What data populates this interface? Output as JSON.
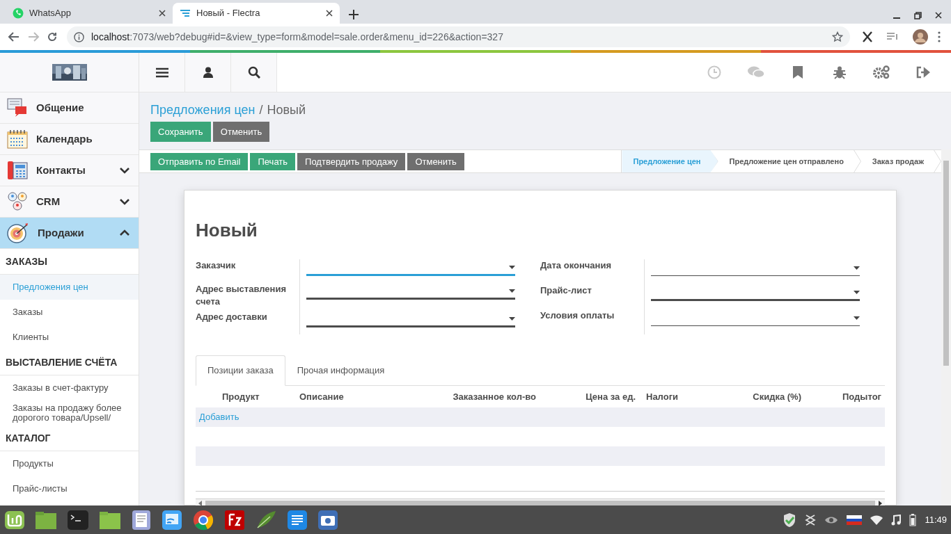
{
  "browser": {
    "tabs": [
      {
        "title": "WhatsApp",
        "selected": false
      },
      {
        "title": "Новый - Flectra",
        "selected": true
      }
    ],
    "address": {
      "host": "localhost",
      "rest": ":7073/web?debug#id=&view_type=form&model=sale.order&menu_id=226&action=327"
    }
  },
  "sidebar": {
    "apps": [
      {
        "label": "Общение",
        "selected": false
      },
      {
        "label": "Календарь",
        "selected": false
      },
      {
        "label": "Контакты",
        "selected": false,
        "expanded": false
      },
      {
        "label": "CRM",
        "selected": false,
        "expanded": false
      },
      {
        "label": "Продажи",
        "selected": true,
        "expanded": true
      }
    ],
    "sections": [
      {
        "heading": "ЗАКАЗЫ",
        "items": [
          {
            "label": "Предложения цен",
            "selected": true
          },
          {
            "label": "Заказы",
            "selected": false
          },
          {
            "label": "Клиенты",
            "selected": false
          }
        ]
      },
      {
        "heading": "ВЫСТАВЛЕНИЕ СЧЁТА",
        "items": [
          {
            "label": "Заказы в счет-фактуру",
            "selected": false
          },
          {
            "label": "Заказы на продажу более дорогого товара/Upsell/",
            "selected": false
          }
        ]
      },
      {
        "heading": "КАТАЛОГ",
        "items": [
          {
            "label": "Продукты",
            "selected": false
          },
          {
            "label": "Прайс-листы",
            "selected": false
          }
        ]
      }
    ]
  },
  "breadcrumb": [
    {
      "label": "Предложения цен",
      "kind": "link"
    },
    {
      "label": "/",
      "kind": "separator"
    },
    {
      "label": "Новый",
      "kind": "current"
    }
  ],
  "control_buttons": [
    {
      "label": "Сохранить",
      "kind": "primary"
    },
    {
      "label": "Отменить",
      "kind": "secondary"
    }
  ],
  "header_buttons": [
    {
      "label": "Отправить по Email",
      "kind": "primary"
    },
    {
      "label": "Печать",
      "kind": "primary"
    },
    {
      "label": "Подтвердить продажу",
      "kind": "secondary"
    },
    {
      "label": "Отменить",
      "kind": "secondary"
    }
  ],
  "status_steps": [
    {
      "label": "Предложение цен",
      "selected": true
    },
    {
      "label": "Предложение цен отправлено",
      "selected": false
    },
    {
      "label": "Заказ продаж",
      "selected": false
    }
  ],
  "form": {
    "title": "Новый",
    "left_fields": [
      {
        "label": "Заказчик",
        "required": true,
        "focused": true
      },
      {
        "label": "Адрес выставления счета",
        "required": true,
        "focused": false
      },
      {
        "label": "Адрес доставки",
        "required": true,
        "focused": false
      }
    ],
    "right_fields": [
      {
        "label": "Дата окончания",
        "required": false,
        "focused": false
      },
      {
        "label": "Прайс-лист",
        "required": true,
        "focused": false
      },
      {
        "label": "Условия оплаты",
        "required": false,
        "focused": false
      }
    ]
  },
  "notebook": {
    "tabs": [
      {
        "label": "Позиции заказа",
        "selected": true
      },
      {
        "label": "Прочая информация",
        "selected": false
      }
    ],
    "columns": [
      "Продукт",
      "Описание",
      "Заказанное кол-во",
      "Цена за ед.",
      "Налоги",
      "Скидка (%)",
      "Подытог"
    ],
    "add_link": "Добавить"
  },
  "taskbar": {
    "clock": "11:49"
  }
}
